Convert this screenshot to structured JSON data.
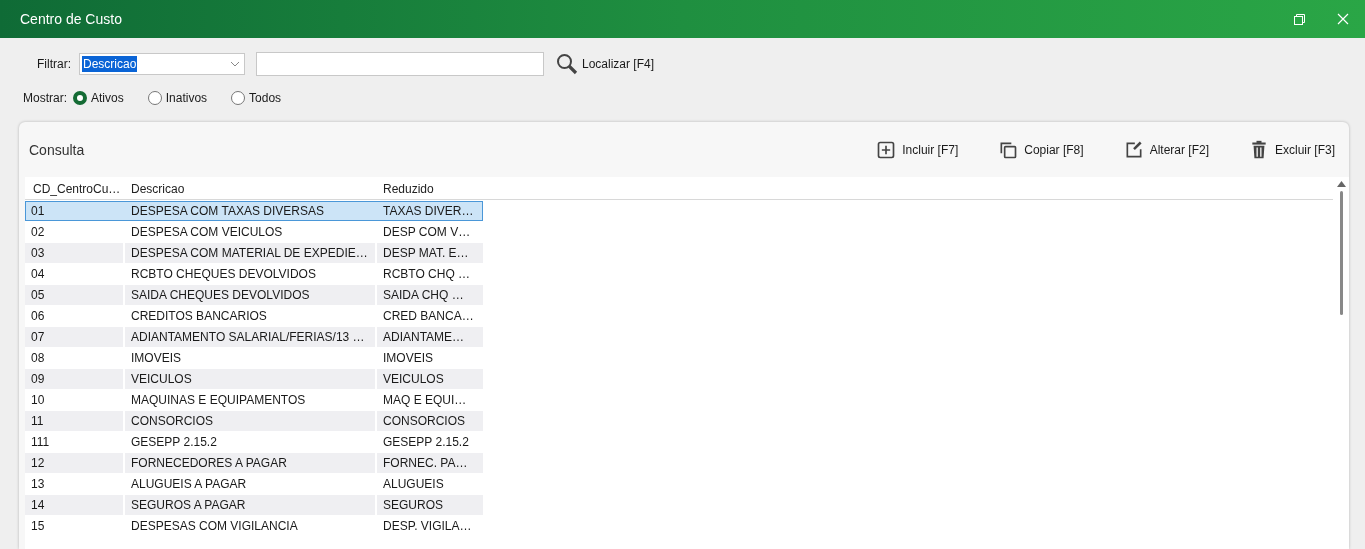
{
  "window": {
    "title": "Centro de Custo"
  },
  "filter": {
    "label": "Filtrar:",
    "field": {
      "value": "Descricao"
    },
    "find_button": "Localizar [F4]"
  },
  "show": {
    "label": "Mostrar:",
    "options": [
      {
        "label": "Ativos",
        "selected": true
      },
      {
        "label": "Inativos",
        "selected": false
      },
      {
        "label": "Todos",
        "selected": false
      }
    ]
  },
  "panel": {
    "title": "Consulta",
    "actions": [
      {
        "kind": "add",
        "label": "Incluir [F7]"
      },
      {
        "kind": "copy",
        "label": "Copiar [F8]"
      },
      {
        "kind": "edit",
        "label": "Alterar [F2]"
      },
      {
        "kind": "delete",
        "label": "Excluir [F3]"
      }
    ]
  },
  "table": {
    "columns": [
      "CD_CentroCu…",
      "Descricao",
      "Reduzido"
    ],
    "rows": [
      {
        "cells": [
          "01",
          "DESPESA COM TAXAS DIVERSAS",
          "TAXAS DIVER…"
        ],
        "selected": true
      },
      {
        "cells": [
          "02",
          "DESPESA COM VEICULOS",
          "DESP COM V…"
        ],
        "selected": false
      },
      {
        "cells": [
          "03",
          "DESPESA COM MATERIAL DE EXPEDIE…",
          "DESP MAT. E…"
        ],
        "selected": false
      },
      {
        "cells": [
          "04",
          "RCBTO CHEQUES DEVOLVIDOS",
          "RCBTO CHQ …"
        ],
        "selected": false
      },
      {
        "cells": [
          "05",
          "SAIDA CHEQUES DEVOLVIDOS",
          "SAIDA CHQ …"
        ],
        "selected": false
      },
      {
        "cells": [
          "06",
          "CREDITOS BANCARIOS",
          "CRED BANCA…"
        ],
        "selected": false
      },
      {
        "cells": [
          "07",
          "ADIANTAMENTO SALARIAL/FERIAS/13 …",
          "ADIANTAME…"
        ],
        "selected": false
      },
      {
        "cells": [
          "08",
          "IMOVEIS",
          "IMOVEIS"
        ],
        "selected": false
      },
      {
        "cells": [
          "09",
          "VEICULOS",
          "VEICULOS"
        ],
        "selected": false
      },
      {
        "cells": [
          "10",
          "MAQUINAS E EQUIPAMENTOS",
          "MAQ E EQUI…"
        ],
        "selected": false
      },
      {
        "cells": [
          "11",
          "CONSORCIOS",
          "CONSORCIOS"
        ],
        "selected": false
      },
      {
        "cells": [
          "111",
          "GESEPP 2.15.2",
          "GESEPP 2.15.2"
        ],
        "selected": false
      },
      {
        "cells": [
          "12",
          "FORNECEDORES A PAGAR",
          "FORNEC. PA…"
        ],
        "selected": false
      },
      {
        "cells": [
          "13",
          "ALUGUEIS A PAGAR",
          "ALUGUEIS"
        ],
        "selected": false
      },
      {
        "cells": [
          "14",
          "SEGUROS A PAGAR",
          "SEGUROS"
        ],
        "selected": false
      },
      {
        "cells": [
          "15",
          "DESPESAS COM VIGILANCIA",
          "DESP. VIGILA…"
        ],
        "selected": false
      }
    ]
  }
}
